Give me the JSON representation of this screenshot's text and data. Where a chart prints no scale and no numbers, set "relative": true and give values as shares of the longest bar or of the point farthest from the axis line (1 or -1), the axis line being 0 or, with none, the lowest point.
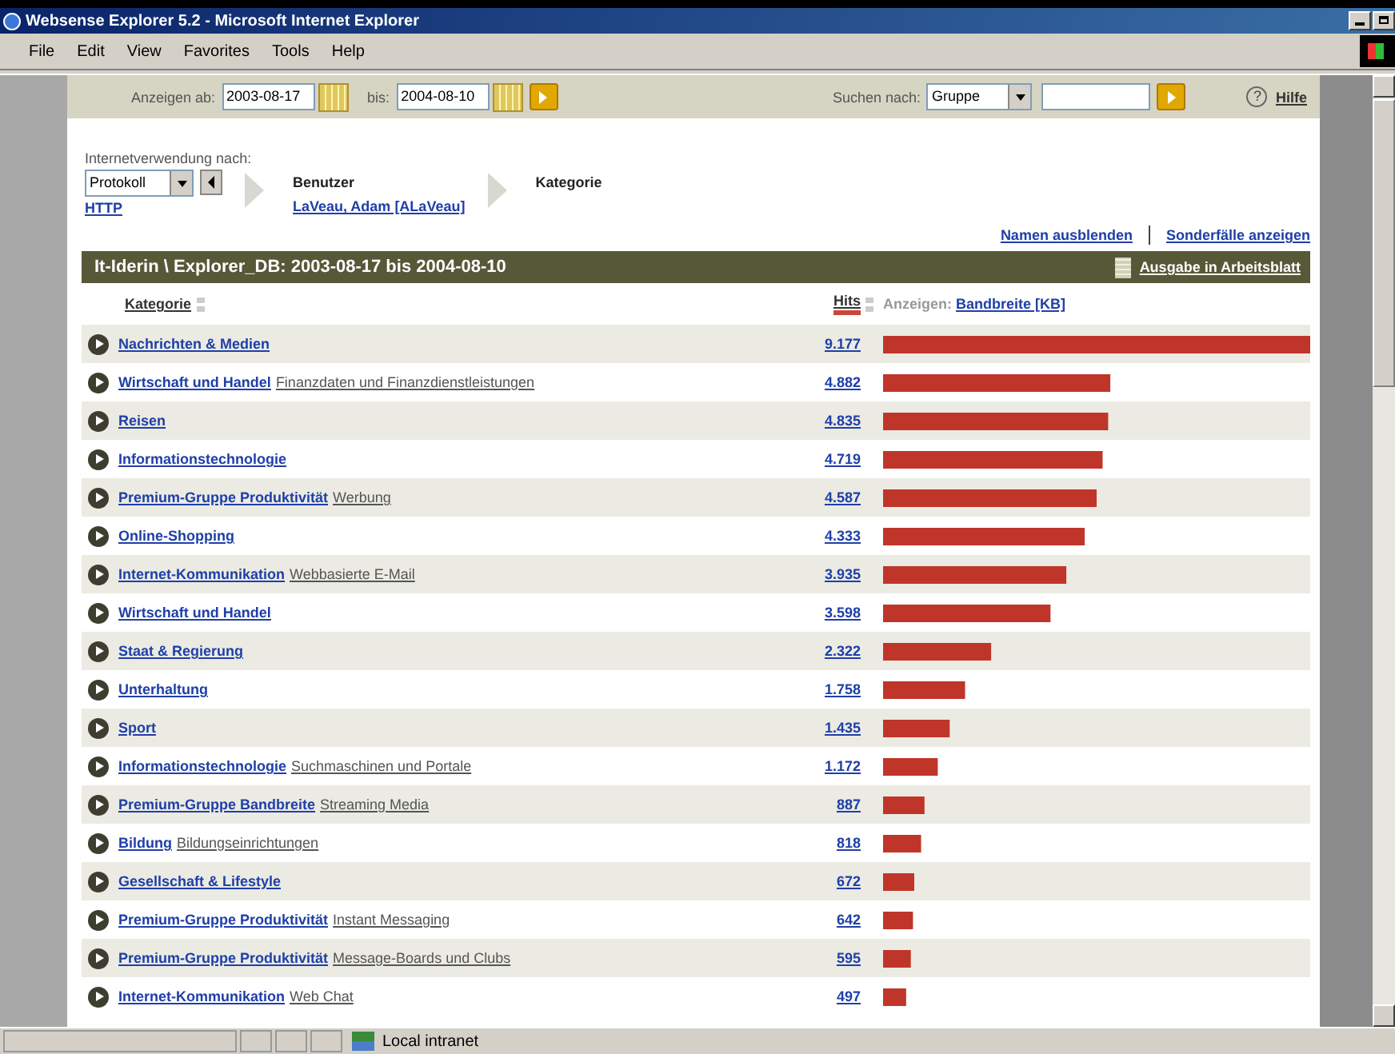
{
  "window": {
    "title": "Websense Explorer 5.2 - Microsoft Internet Explorer"
  },
  "menu": [
    "File",
    "Edit",
    "View",
    "Favorites",
    "Tools",
    "Help"
  ],
  "toolbar": {
    "from_label": "Anzeigen ab:",
    "from_value": "2003-08-17",
    "to_label": "bis:",
    "to_value": "2004-08-10",
    "search_label": "Suchen nach:",
    "search_select": "Gruppe",
    "help_icon": "?",
    "help": "Hilfe"
  },
  "breadcrumb": {
    "label": "Internetverwendung nach:",
    "steps": [
      {
        "kind": "select",
        "value": "Protokoll",
        "link": "HTTP"
      },
      {
        "kind": "step",
        "title": "Benutzer",
        "link": "LaVeau, Adam [ALaVeau]"
      },
      {
        "kind": "step",
        "title": "Kategorie"
      }
    ]
  },
  "actions": [
    "Namen ausblenden",
    "Sonderfälle anzeigen"
  ],
  "report": {
    "title": "It-Iderin \\ Explorer_DB: 2003-08-17 bis 2004-08-10",
    "export": "Ausgabe in Arbeitsblatt"
  },
  "columns": {
    "category": "Kategorie",
    "hits": "Hits",
    "show_label": "Anzeigen:",
    "show_value": "Bandbreite [KB]"
  },
  "rows": [
    {
      "category": "Nachrichten & Medien",
      "hits": "9.177"
    },
    {
      "category": "Wirtschaft und Handel",
      "subcategory": "Finanzdaten und Finanzdienstleistungen",
      "hits": "4.882"
    },
    {
      "category": "Reisen",
      "hits": "4.835"
    },
    {
      "category": "Informationstechnologie",
      "hits": "4.719"
    },
    {
      "category": "Premium-Gruppe Produktivität",
      "subcategory": "Werbung",
      "hits": "4.587"
    },
    {
      "category": "Online-Shopping",
      "hits": "4.333"
    },
    {
      "category": "Internet-Kommunikation",
      "subcategory": "Webbasierte E-Mail",
      "hits": "3.935"
    },
    {
      "category": "Wirtschaft und Handel",
      "hits": "3.598"
    },
    {
      "category": "Staat & Regierung",
      "hits": "2.322"
    },
    {
      "category": "Unterhaltung",
      "hits": "1.758"
    },
    {
      "category": "Sport",
      "hits": "1.435"
    },
    {
      "category": "Informationstechnologie",
      "subcategory": "Suchmaschinen und Portale",
      "hits": "1.172"
    },
    {
      "category": "Premium-Gruppe Bandbreite",
      "subcategory": "Streaming Media",
      "hits": "887"
    },
    {
      "category": "Bildung",
      "subcategory": "Bildungseinrichtungen",
      "hits": "818"
    },
    {
      "category": "Gesellschaft & Lifestyle",
      "hits": "672"
    },
    {
      "category": "Premium-Gruppe Produktivität",
      "subcategory": "Instant Messaging",
      "hits": "642"
    },
    {
      "category": "Premium-Gruppe Produktivität",
      "subcategory": "Message-Boards und Clubs",
      "hits": "595"
    },
    {
      "category": "Internet-Kommunikation",
      "subcategory": "Web Chat",
      "hits": "497"
    }
  ],
  "chart_data": {
    "type": "bar",
    "orientation": "horizontal",
    "relative": true,
    "categories": [
      null,
      null,
      null,
      null,
      null,
      null,
      null,
      null,
      null,
      null,
      null,
      null,
      null,
      null,
      null,
      null,
      null,
      null
    ],
    "series": [
      {
        "color": "#c0352a",
        "values": [
          1,
          0.532,
          0.527,
          0.514,
          0.5,
          0.472,
          0.429,
          0.392,
          0.253,
          0.192,
          0.156,
          0.128,
          0.097,
          0.089,
          0.073,
          0.07,
          0.065,
          0.054
        ]
      }
    ]
  },
  "status_bar": {
    "zone": "Local intranet"
  }
}
